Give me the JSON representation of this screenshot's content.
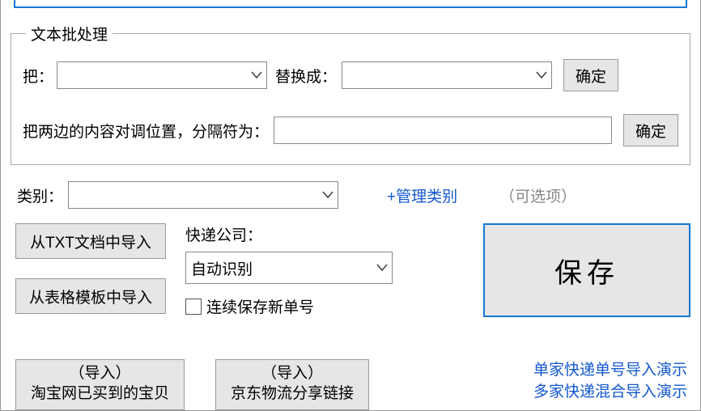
{
  "text_batch": {
    "legend": "文本批处理",
    "row1": {
      "put_label": "把：",
      "replace_with_label": "替换成：",
      "confirm_label": "确定"
    },
    "row2": {
      "swap_label": "把两边的内容对调位置，分隔符为：",
      "confirm_label": "确定"
    }
  },
  "category": {
    "label": "类别：",
    "manage_label": "+管理类别",
    "optional_label": "（可选项）"
  },
  "import_txt_label": "从TXT文档中导入",
  "import_table_label": "从表格模板中导入",
  "courier": {
    "label": "快递公司：",
    "selected": "自动识别",
    "continuous_save_label": "连续保存新单号"
  },
  "save_label": "保存",
  "bottom": {
    "taobao_top": "（导入）",
    "taobao_bottom": "淘宝网已买到的宝贝",
    "jd_top": "（导入）",
    "jd_bottom": "京东物流分享链接",
    "demo1": "单家快递单号导入演示",
    "demo2": "多家快递混合导入演示"
  }
}
